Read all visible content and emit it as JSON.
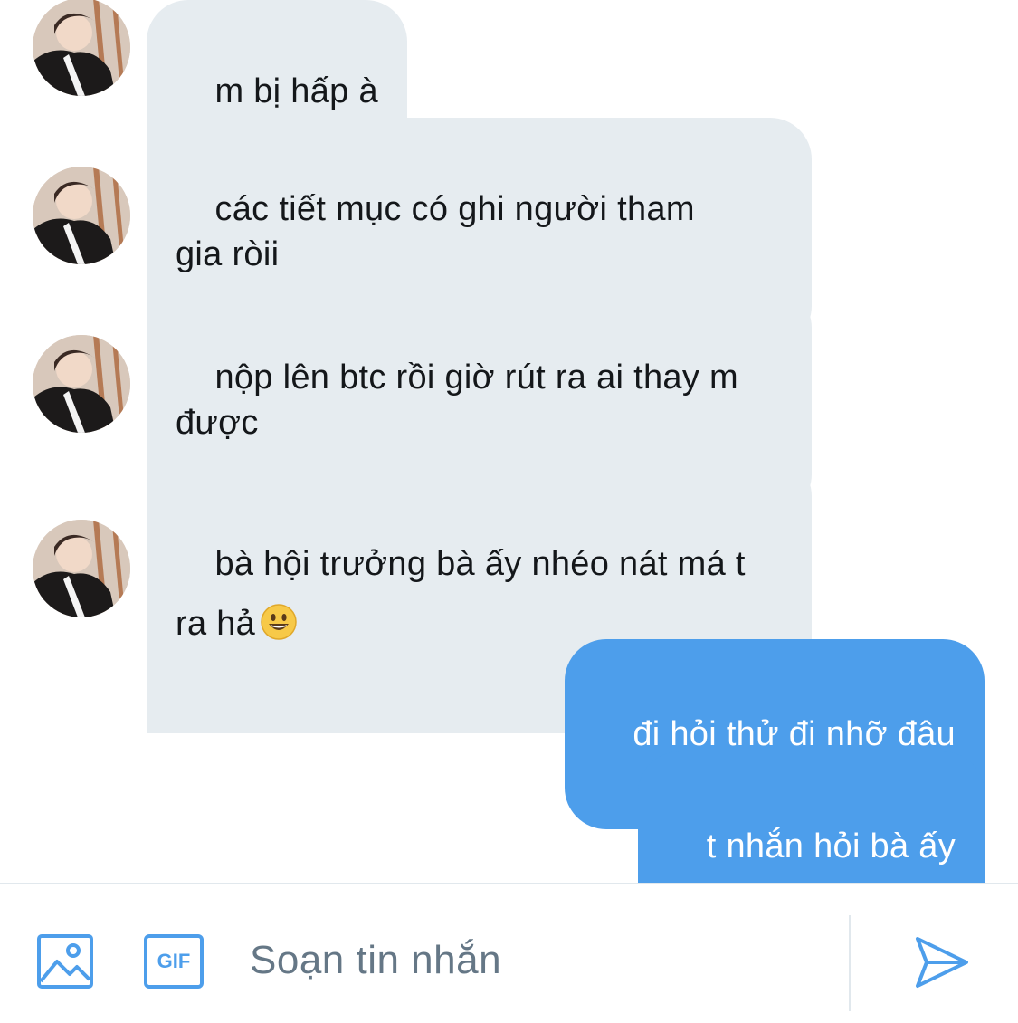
{
  "colors": {
    "incoming_bubble": "#e6ecf0",
    "outgoing_bubble": "#4d9eeb",
    "accent": "#4d9eeb",
    "divider": "#e1e8ed",
    "placeholder": "#657786"
  },
  "messages": [
    {
      "direction": "incoming",
      "text": "m bị hấp à",
      "avatar": "user-avatar"
    },
    {
      "direction": "incoming",
      "text": "các tiết mục có ghi người tham\ngia ròii",
      "avatar": "user-avatar"
    },
    {
      "direction": "incoming",
      "text": "nộp lên btc rồi giờ rút ra ai thay m\nđược",
      "avatar": "user-avatar"
    },
    {
      "direction": "incoming",
      "text": "bà hội trưởng bà ấy nhéo nát má t\nra hả",
      "emoji": "grinning-face-emoji",
      "avatar": "user-avatar"
    },
    {
      "direction": "outgoing",
      "text": "đi hỏi thử đi nhỡ đâu"
    },
    {
      "direction": "outgoing",
      "text": "t nhắn hỏi bà ấy"
    }
  ],
  "composer": {
    "media_icon": "image-icon",
    "gif_icon": "gif-icon",
    "gif_label": "GIF",
    "placeholder": "Soạn tin nhắn",
    "value": "",
    "send_icon": "send-icon"
  }
}
